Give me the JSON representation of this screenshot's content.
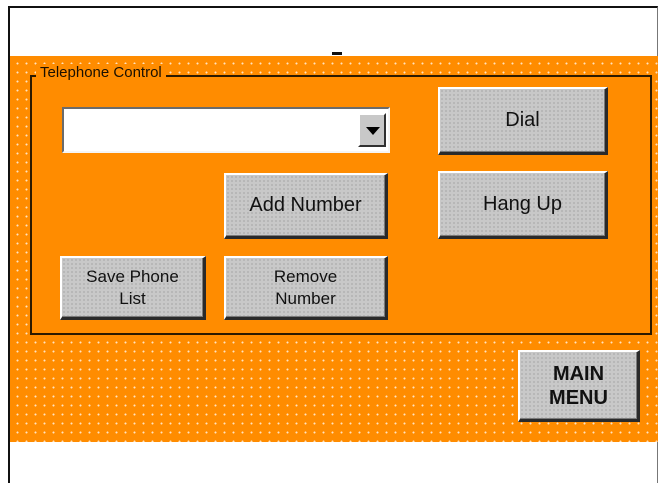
{
  "group": {
    "label": "Telephone Control"
  },
  "combo": {
    "value": ""
  },
  "buttons": {
    "dial": "Dial",
    "hang_up": "Hang Up",
    "add_number": "Add Number",
    "save_phone_list_line1": "Save Phone",
    "save_phone_list_line2": "List",
    "remove_number_line1": "Remove",
    "remove_number_line2": "Number",
    "main_menu_line1": "MAIN",
    "main_menu_line2": "MENU"
  },
  "colors": {
    "form_background": "#ff8c00",
    "button_face": "#c8c8c8",
    "text": "#111111"
  }
}
